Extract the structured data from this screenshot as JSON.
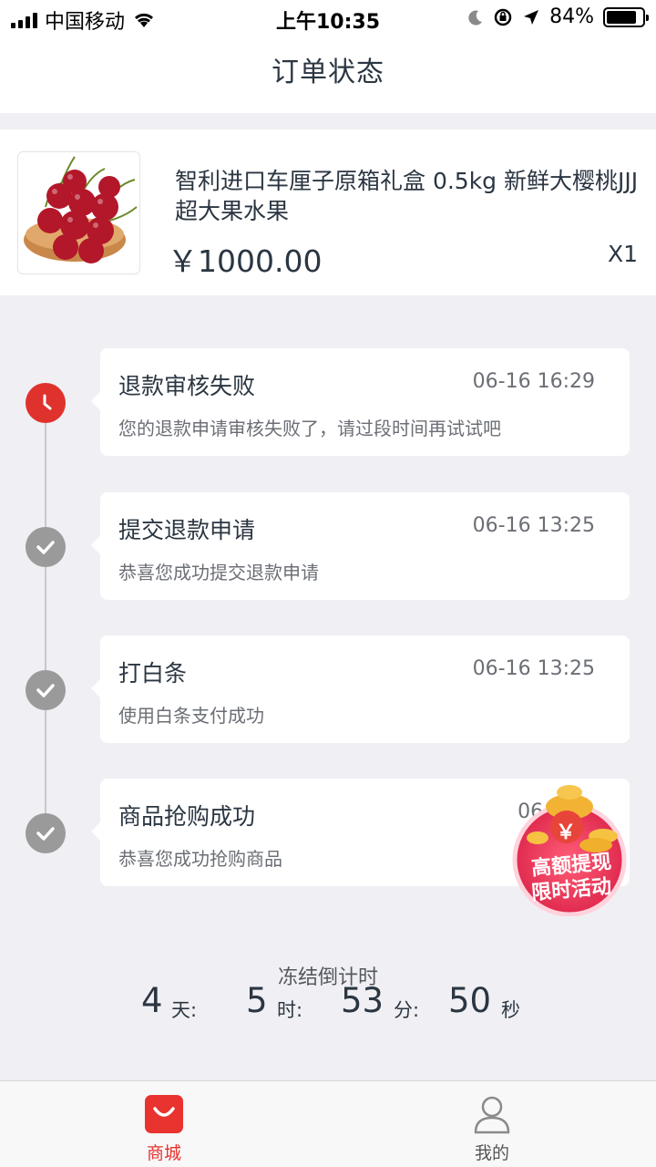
{
  "status_bar": {
    "carrier": "中国移动",
    "time": "上午10:35",
    "battery": "84%",
    "battery_level": 0.84
  },
  "nav": {
    "title": "订单状态"
  },
  "product": {
    "name": "智利进口车厘子原箱礼盒 0.5kg 新鲜大樱桃JJJ超大果水果",
    "price": "￥1000.00",
    "quantity": "X1",
    "image_icon": "cherry-product-image"
  },
  "timeline": [
    {
      "title": "退款审核失败",
      "time": "06-16 16:29",
      "desc": "您的退款申请审核失败了，请过段时间再试试吧",
      "icon": "clock-icon",
      "color": "#e0322d"
    },
    {
      "title": "提交退款申请",
      "time": "06-16 13:25",
      "desc": "恭喜您成功提交退款申请",
      "icon": "check-icon",
      "color": "#9a9a9a"
    },
    {
      "title": "打白条",
      "time": "06-16 13:25",
      "desc": "使用白条支付成功",
      "icon": "check-icon",
      "color": "#9a9a9a"
    },
    {
      "title": "商品抢购成功",
      "time": "06-16 1",
      "desc": "恭喜您成功抢购商品",
      "icon": "check-icon",
      "color": "#9a9a9a"
    }
  ],
  "promo": {
    "line1": "高额提现",
    "line2": "限时活动",
    "symbol": "￥"
  },
  "countdown": {
    "label": "冻结倒计时",
    "days": "4",
    "days_unit": "天:",
    "hours": "5",
    "hours_unit": "时:",
    "minutes": "53",
    "minutes_unit": "分:",
    "seconds": "50",
    "seconds_unit": "秒"
  },
  "tabbar": {
    "items": [
      {
        "label": "商城",
        "icon": "shopping-bag-icon",
        "active": true
      },
      {
        "label": "我的",
        "icon": "user-icon",
        "active": false
      }
    ]
  },
  "colors": {
    "accent": "#e8332f",
    "text": "#2b3642",
    "muted": "#6b6f75",
    "background": "#f0f0f4"
  }
}
